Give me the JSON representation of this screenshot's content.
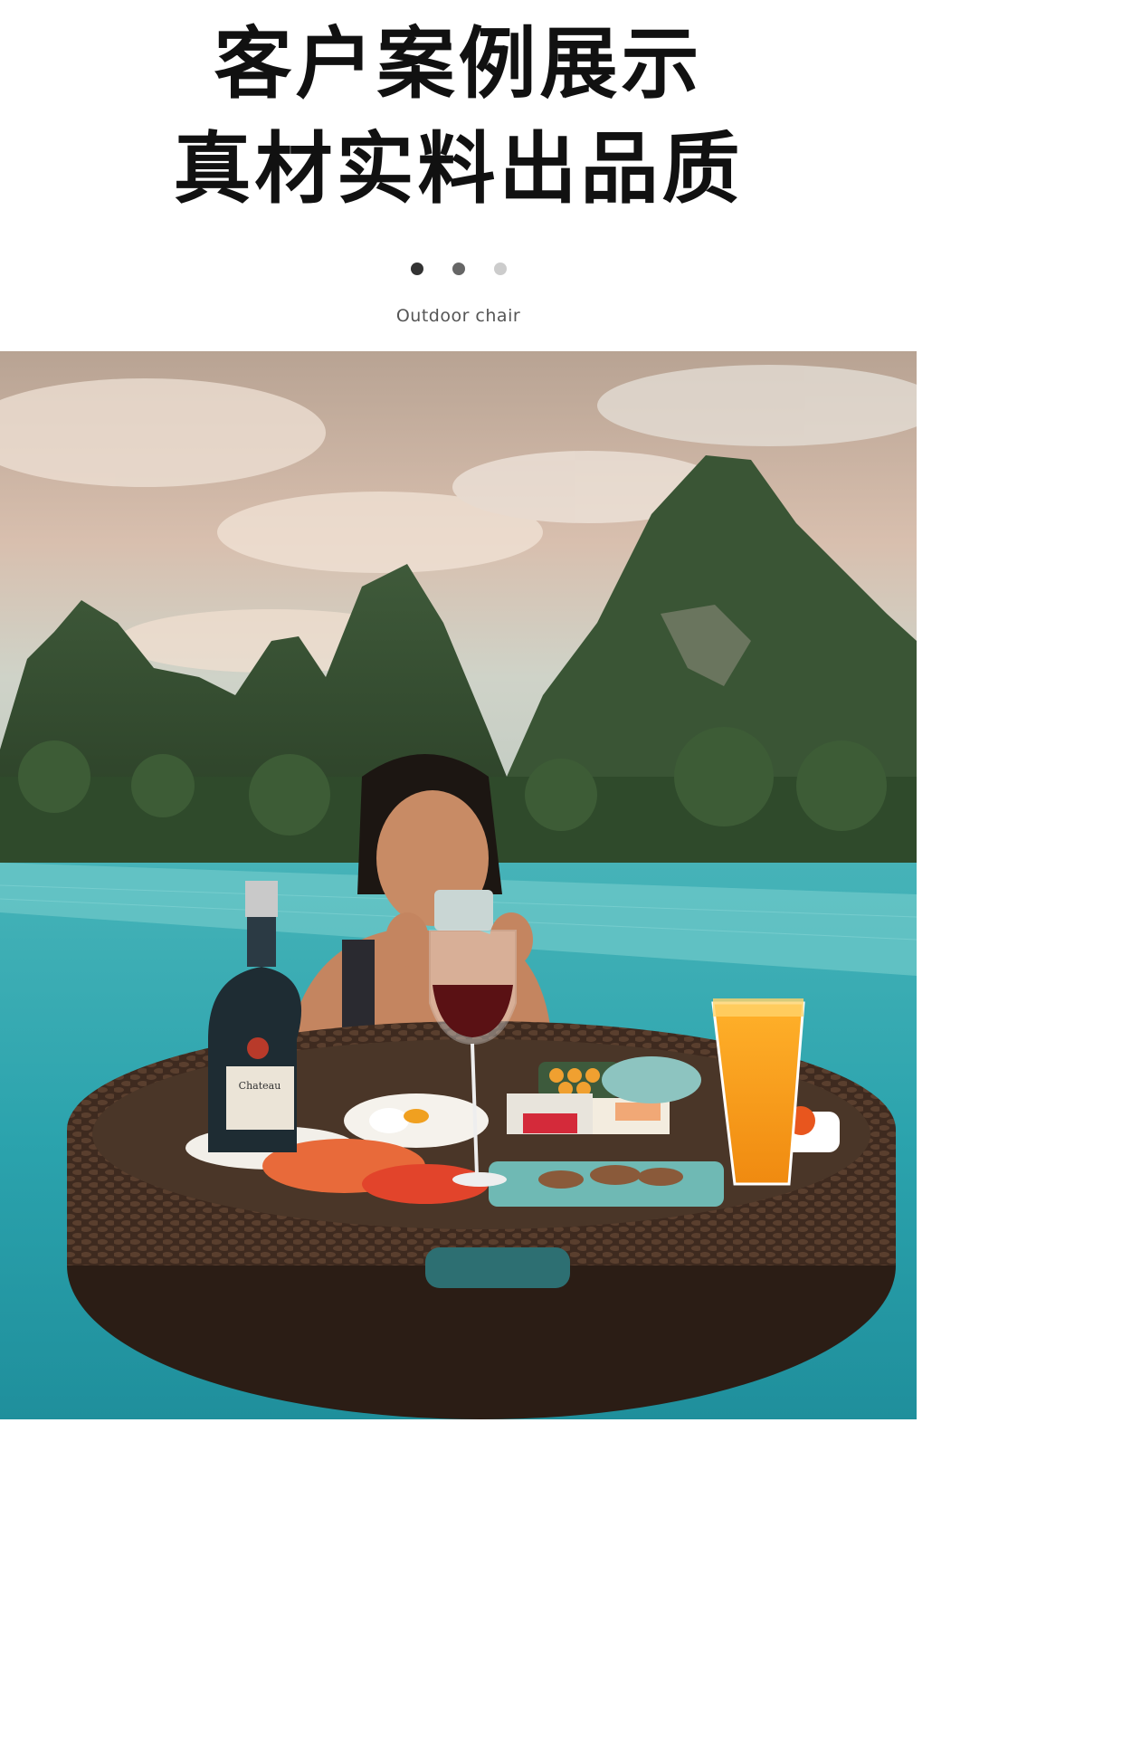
{
  "header": {
    "title_line1": "客户案例展示",
    "title_line2": "真材实料出品质",
    "caption": "Outdoor chair"
  },
  "carousel": {
    "dots": [
      {
        "color": "#333333"
      },
      {
        "color": "#666666"
      },
      {
        "color": "#cccccc"
      }
    ]
  },
  "photo": {
    "bottle_label": "Chateau"
  }
}
